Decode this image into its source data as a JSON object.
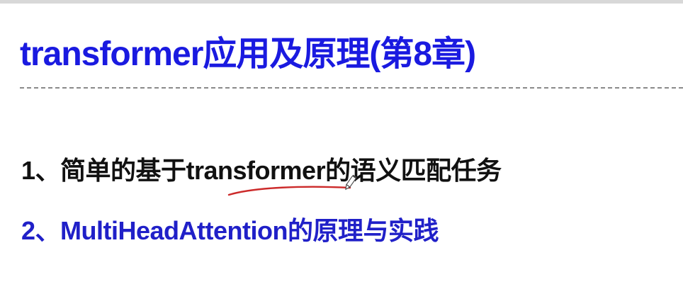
{
  "slide": {
    "title": "transformer应用及原理(第8章)",
    "items": [
      {
        "text": "1、简单的基于transformer的语义匹配任务"
      },
      {
        "text": "2、MultiHeadAttention的原理与实践"
      }
    ]
  },
  "colors": {
    "title": "#1a1ae0",
    "item_default": "#111111",
    "item_highlight": "#2020c8",
    "annotation": "#cc2a2a",
    "separator": "#8a8a8a",
    "background": "#ffffff"
  },
  "icons": {
    "annotation_cursor": "pen-cursor-icon"
  }
}
